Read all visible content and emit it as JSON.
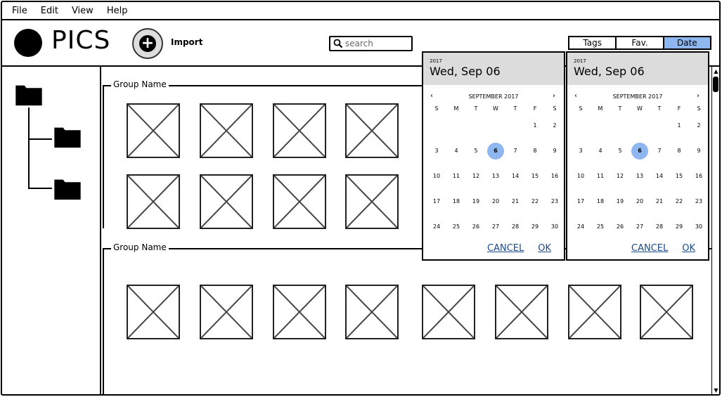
{
  "menu": [
    "File",
    "Edit",
    "View",
    "Help"
  ],
  "header": {
    "title": "PICS",
    "import_label": "Import",
    "search_placeholder": "search",
    "tabs": [
      "Tags",
      "Fav.",
      "Date"
    ],
    "active_tab": "Date"
  },
  "groups": [
    {
      "label": "Group Name"
    },
    {
      "label": "Group Name"
    }
  ],
  "pickers": [
    {
      "year": "2017",
      "date": "Wed, Sep 06",
      "month": "SEPTEMBER 2017",
      "weekdays": [
        "S",
        "M",
        "T",
        "W",
        "T",
        "F",
        "S"
      ],
      "weeks": [
        [
          "",
          "",
          "",
          "",
          "",
          "1",
          "2"
        ],
        [
          "3",
          "4",
          "5",
          "6",
          "7",
          "8",
          "9"
        ],
        [
          "10",
          "11",
          "12",
          "13",
          "14",
          "15",
          "16"
        ],
        [
          "17",
          "18",
          "19",
          "20",
          "21",
          "22",
          "23"
        ],
        [
          "24",
          "25",
          "26",
          "27",
          "28",
          "29",
          "30"
        ]
      ],
      "selected": "6",
      "cancel": "CANCEL",
      "ok": "OK"
    },
    {
      "year": "2017",
      "date": "Wed, Sep 06",
      "month": "SEPTEMBER 2017",
      "weekdays": [
        "S",
        "M",
        "T",
        "W",
        "T",
        "F",
        "S"
      ],
      "weeks": [
        [
          "",
          "",
          "",
          "",
          "",
          "1",
          "2"
        ],
        [
          "3",
          "4",
          "5",
          "6",
          "7",
          "8",
          "9"
        ],
        [
          "10",
          "11",
          "12",
          "13",
          "14",
          "15",
          "16"
        ],
        [
          "17",
          "18",
          "19",
          "20",
          "21",
          "22",
          "23"
        ],
        [
          "24",
          "25",
          "26",
          "27",
          "28",
          "29",
          "30"
        ]
      ],
      "selected": "6",
      "cancel": "CANCEL",
      "ok": "OK"
    }
  ],
  "colors": {
    "accent": "#8fb7ef",
    "header_bg": "#dcdcdc",
    "link": "#1a4a8a"
  }
}
